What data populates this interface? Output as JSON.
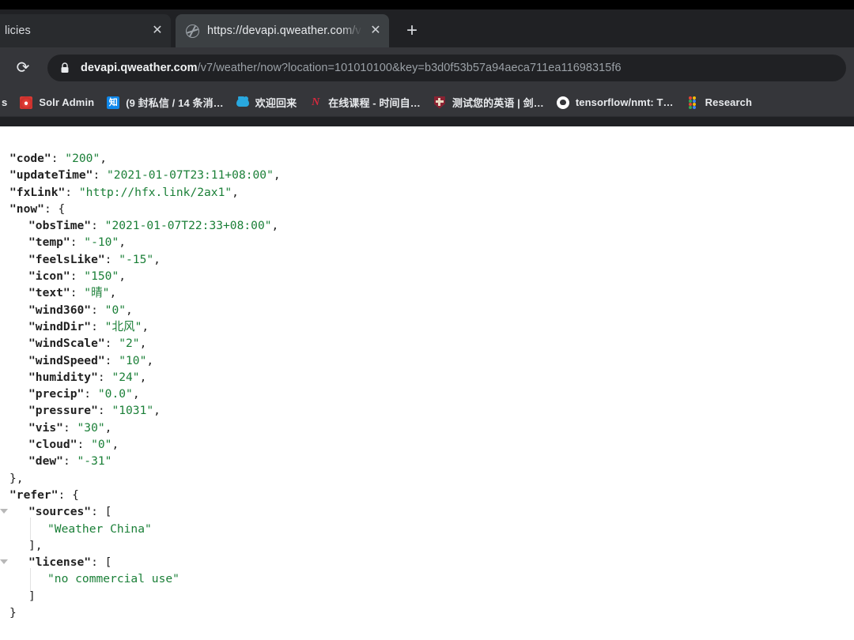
{
  "browser": {
    "tabs": [
      {
        "title": "licies",
        "favicon": "none",
        "active": false,
        "close_label": "✕"
      },
      {
        "title": "https://devapi.qweather.com/v",
        "favicon": "globe-icon",
        "active": true,
        "close_label": "✕"
      }
    ],
    "new_tab_label": "+",
    "reload_label": "⟳",
    "omnibox": {
      "lock_icon": "lock-icon",
      "domain": "devapi.qweather.com",
      "path": "/v7/weather/now?location=101010100&key=b3d0f53b57a94aeca711ea11698315f6"
    },
    "bookmarks": [
      {
        "label": "s",
        "icon": "clipped-icon"
      },
      {
        "label": "Solr Admin",
        "icon": "solr-icon"
      },
      {
        "label": "(9 封私信 / 14 条消…",
        "icon": "zhihu-icon",
        "icon_text": "知"
      },
      {
        "label": "欢迎回来",
        "icon": "cloud-icon"
      },
      {
        "label": "在线课程 - 时间自…",
        "icon": "netease-icon",
        "icon_text": "N"
      },
      {
        "label": "测试您的英语 | 剑…",
        "icon": "cambridge-shield-icon"
      },
      {
        "label": "tensorflow/nmt: T…",
        "icon": "github-icon"
      },
      {
        "label": "Research",
        "icon": "dots-icon"
      }
    ]
  },
  "page": {
    "content_type": "json-viewer",
    "json_lines": [
      {
        "indent": 0,
        "triangle": false,
        "parts": [
          {
            "t": "\"code\"",
            "c": "k"
          },
          {
            "t": ": ",
            "c": "p"
          },
          {
            "t": "\"200\"",
            "c": "s"
          },
          {
            "t": ",",
            "c": "p"
          }
        ]
      },
      {
        "indent": 0,
        "triangle": false,
        "parts": [
          {
            "t": "\"updateTime\"",
            "c": "k"
          },
          {
            "t": ": ",
            "c": "p"
          },
          {
            "t": "\"2021-01-07T23:11+08:00\"",
            "c": "s"
          },
          {
            "t": ",",
            "c": "p"
          }
        ]
      },
      {
        "indent": 0,
        "triangle": false,
        "parts": [
          {
            "t": "\"fxLink\"",
            "c": "k"
          },
          {
            "t": ": ",
            "c": "p"
          },
          {
            "t": "\"http://hfx.link/2ax1\"",
            "c": "s"
          },
          {
            "t": ",",
            "c": "p"
          }
        ]
      },
      {
        "indent": 0,
        "triangle": false,
        "parts": [
          {
            "t": "\"now\"",
            "c": "k"
          },
          {
            "t": ": {",
            "c": "p"
          }
        ]
      },
      {
        "indent": 1,
        "triangle": false,
        "parts": [
          {
            "t": "\"obsTime\"",
            "c": "k"
          },
          {
            "t": ": ",
            "c": "p"
          },
          {
            "t": "\"2021-01-07T22:33+08:00\"",
            "c": "s"
          },
          {
            "t": ",",
            "c": "p"
          }
        ]
      },
      {
        "indent": 1,
        "triangle": false,
        "parts": [
          {
            "t": "\"temp\"",
            "c": "k"
          },
          {
            "t": ": ",
            "c": "p"
          },
          {
            "t": "\"-10\"",
            "c": "s"
          },
          {
            "t": ",",
            "c": "p"
          }
        ]
      },
      {
        "indent": 1,
        "triangle": false,
        "parts": [
          {
            "t": "\"feelsLike\"",
            "c": "k"
          },
          {
            "t": ": ",
            "c": "p"
          },
          {
            "t": "\"-15\"",
            "c": "s"
          },
          {
            "t": ",",
            "c": "p"
          }
        ]
      },
      {
        "indent": 1,
        "triangle": false,
        "parts": [
          {
            "t": "\"icon\"",
            "c": "k"
          },
          {
            "t": ": ",
            "c": "p"
          },
          {
            "t": "\"150\"",
            "c": "s"
          },
          {
            "t": ",",
            "c": "p"
          }
        ]
      },
      {
        "indent": 1,
        "triangle": false,
        "parts": [
          {
            "t": "\"text\"",
            "c": "k"
          },
          {
            "t": ": ",
            "c": "p"
          },
          {
            "t": "\"晴\"",
            "c": "s"
          },
          {
            "t": ",",
            "c": "p"
          }
        ]
      },
      {
        "indent": 1,
        "triangle": false,
        "parts": [
          {
            "t": "\"wind360\"",
            "c": "k"
          },
          {
            "t": ": ",
            "c": "p"
          },
          {
            "t": "\"0\"",
            "c": "s"
          },
          {
            "t": ",",
            "c": "p"
          }
        ]
      },
      {
        "indent": 1,
        "triangle": false,
        "parts": [
          {
            "t": "\"windDir\"",
            "c": "k"
          },
          {
            "t": ": ",
            "c": "p"
          },
          {
            "t": "\"北风\"",
            "c": "s"
          },
          {
            "t": ",",
            "c": "p"
          }
        ]
      },
      {
        "indent": 1,
        "triangle": false,
        "parts": [
          {
            "t": "\"windScale\"",
            "c": "k"
          },
          {
            "t": ": ",
            "c": "p"
          },
          {
            "t": "\"2\"",
            "c": "s"
          },
          {
            "t": ",",
            "c": "p"
          }
        ]
      },
      {
        "indent": 1,
        "triangle": false,
        "parts": [
          {
            "t": "\"windSpeed\"",
            "c": "k"
          },
          {
            "t": ": ",
            "c": "p"
          },
          {
            "t": "\"10\"",
            "c": "s"
          },
          {
            "t": ",",
            "c": "p"
          }
        ]
      },
      {
        "indent": 1,
        "triangle": false,
        "parts": [
          {
            "t": "\"humidity\"",
            "c": "k"
          },
          {
            "t": ": ",
            "c": "p"
          },
          {
            "t": "\"24\"",
            "c": "s"
          },
          {
            "t": ",",
            "c": "p"
          }
        ]
      },
      {
        "indent": 1,
        "triangle": false,
        "parts": [
          {
            "t": "\"precip\"",
            "c": "k"
          },
          {
            "t": ": ",
            "c": "p"
          },
          {
            "t": "\"0.0\"",
            "c": "s"
          },
          {
            "t": ",",
            "c": "p"
          }
        ]
      },
      {
        "indent": 1,
        "triangle": false,
        "parts": [
          {
            "t": "\"pressure\"",
            "c": "k"
          },
          {
            "t": ": ",
            "c": "p"
          },
          {
            "t": "\"1031\"",
            "c": "s"
          },
          {
            "t": ",",
            "c": "p"
          }
        ]
      },
      {
        "indent": 1,
        "triangle": false,
        "parts": [
          {
            "t": "\"vis\"",
            "c": "k"
          },
          {
            "t": ": ",
            "c": "p"
          },
          {
            "t": "\"30\"",
            "c": "s"
          },
          {
            "t": ",",
            "c": "p"
          }
        ]
      },
      {
        "indent": 1,
        "triangle": false,
        "parts": [
          {
            "t": "\"cloud\"",
            "c": "k"
          },
          {
            "t": ": ",
            "c": "p"
          },
          {
            "t": "\"0\"",
            "c": "s"
          },
          {
            "t": ",",
            "c": "p"
          }
        ]
      },
      {
        "indent": 1,
        "triangle": false,
        "parts": [
          {
            "t": "\"dew\"",
            "c": "k"
          },
          {
            "t": ": ",
            "c": "p"
          },
          {
            "t": "\"-31\"",
            "c": "s"
          }
        ]
      },
      {
        "indent": 0,
        "triangle": false,
        "parts": [
          {
            "t": "},",
            "c": "p"
          }
        ]
      },
      {
        "indent": 0,
        "triangle": false,
        "parts": [
          {
            "t": "\"refer\"",
            "c": "k"
          },
          {
            "t": ": {",
            "c": "p"
          }
        ]
      },
      {
        "indent": 1,
        "triangle": true,
        "parts": [
          {
            "t": "\"sources\"",
            "c": "k"
          },
          {
            "t": ": [",
            "c": "p"
          }
        ]
      },
      {
        "indent": 2,
        "triangle": false,
        "parts": [
          {
            "t": "\"Weather China\"",
            "c": "s"
          }
        ]
      },
      {
        "indent": 1,
        "triangle": false,
        "parts": [
          {
            "t": "],",
            "c": "p"
          }
        ]
      },
      {
        "indent": 1,
        "triangle": true,
        "parts": [
          {
            "t": "\"license\"",
            "c": "k"
          },
          {
            "t": ": [",
            "c": "p"
          }
        ]
      },
      {
        "indent": 2,
        "triangle": false,
        "parts": [
          {
            "t": "\"no commercial use\"",
            "c": "s"
          }
        ]
      },
      {
        "indent": 1,
        "triangle": false,
        "parts": [
          {
            "t": "]",
            "c": "p"
          }
        ]
      },
      {
        "indent": 0,
        "triangle": false,
        "parts": [
          {
            "t": "}",
            "c": "p"
          }
        ]
      }
    ]
  },
  "colors": {
    "chrome_bg": "#202124",
    "toolbar_bg": "#35363a",
    "active_tab_bg": "#3c4043",
    "inactive_tab_bg": "#292b2e",
    "json_key": "#212121",
    "json_string": "#1a7f37",
    "page_bg": "#ffffff",
    "zhihu_blue": "#0f88eb"
  }
}
